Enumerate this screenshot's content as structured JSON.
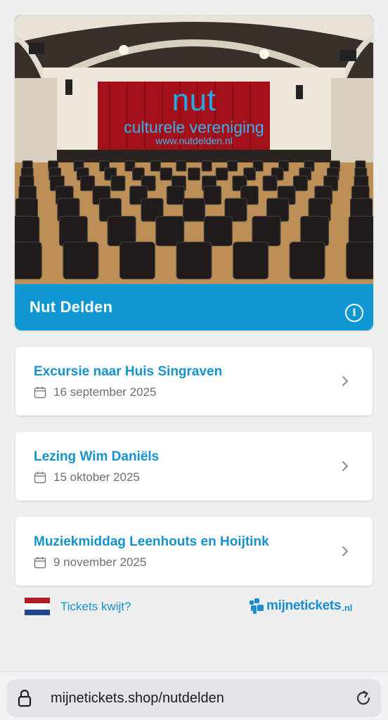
{
  "header": {
    "hero_title": "nut",
    "hero_subtitle": "culturele vereniging",
    "hero_url": "www.nutdelden.nl",
    "org_name": "Nut Delden",
    "info_icon": "info-icon",
    "accent_color": "#0f97d3"
  },
  "events": [
    {
      "title": "Excursie naar Huis Singraven",
      "date": "16 september 2025"
    },
    {
      "title": "Lezing Wim Daniëls",
      "date": "15 oktober 2025"
    },
    {
      "title": "Muziekmiddag Leenhouts en Hoijtink",
      "date": "9 november 2025"
    }
  ],
  "footer": {
    "lost_tickets": "Tickets kwijt?",
    "brand_name": "mijnetickets",
    "brand_tld": ".nl",
    "flag_icon": "netherlands-flag-icon"
  },
  "browser": {
    "url": "mijnetickets.shop/nutdelden",
    "lock_icon": "lock-icon",
    "reload_icon": "reload-icon"
  }
}
